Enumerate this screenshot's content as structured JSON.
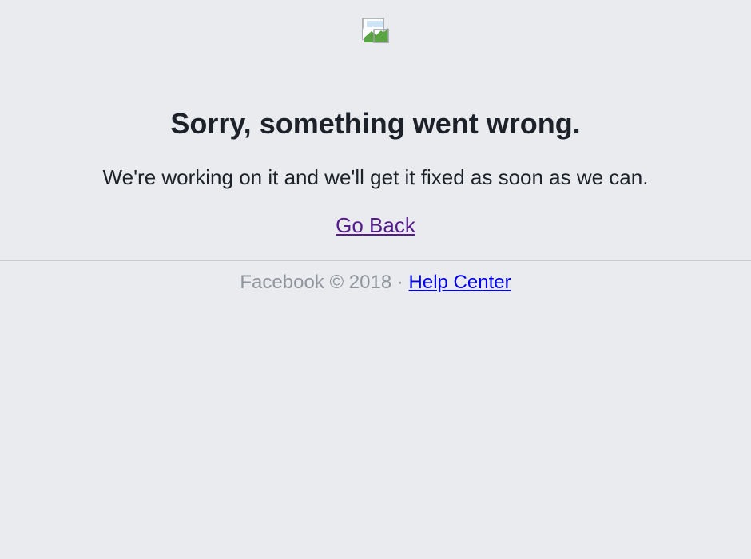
{
  "error": {
    "image_icon": "broken-image-icon",
    "title": "Sorry, something went wrong.",
    "message": "We're working on it and we'll get it fixed as soon as we can.",
    "back_link": "Go Back"
  },
  "footer": {
    "copyright": "Facebook © 2018",
    "separator": " · ",
    "help_link": "Help Center"
  },
  "colors": {
    "background": "#e9ebee",
    "visited_link": "#551a8b",
    "link": "#0000ee",
    "footer_text": "#90949c"
  }
}
